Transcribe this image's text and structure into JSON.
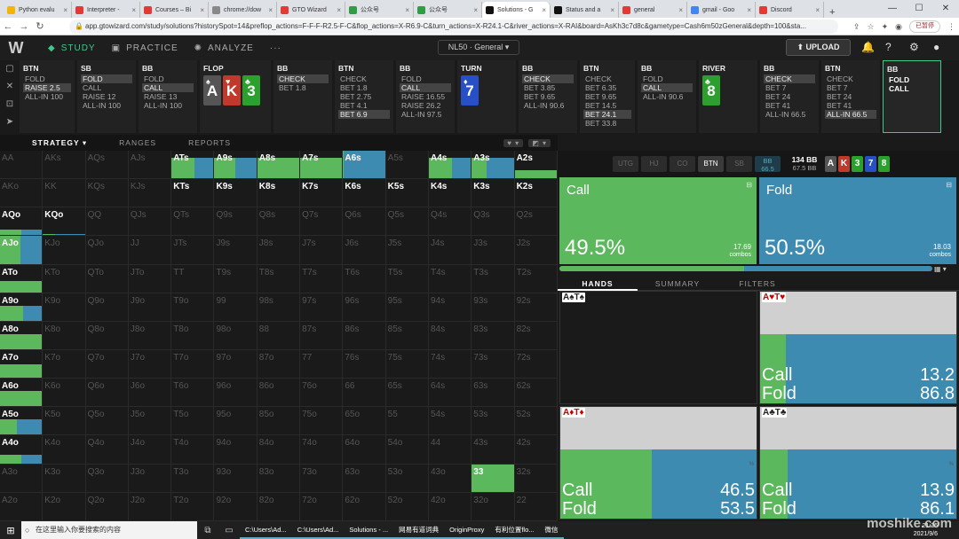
{
  "browser": {
    "tabs": [
      {
        "label": "Python evalu",
        "color": "#f4b400"
      },
      {
        "label": "Interpreter -",
        "color": "#e53935"
      },
      {
        "label": "Courses – Bi",
        "color": "#e53935"
      },
      {
        "label": "chrome://dow",
        "color": "#888"
      },
      {
        "label": "GTO Wizard",
        "color": "#e53935"
      },
      {
        "label": "公众号",
        "color": "#2e9e44"
      },
      {
        "label": "公众号",
        "color": "#2e9e44"
      },
      {
        "label": "Solutions - G",
        "color": "#111",
        "active": true
      },
      {
        "label": "Status and a",
        "color": "#111"
      },
      {
        "label": "general",
        "color": "#e53935"
      },
      {
        "label": "gmail - Goo",
        "color": "#4285f4"
      },
      {
        "label": "Discord",
        "color": "#e53935"
      }
    ],
    "new_tab": "+",
    "url": "app.gtowizard.com/study/solutions?historySpot=14&preflop_actions=F-F-F-R2.5-F-C&flop_actions=X-R6.9-C&turn_actions=X-R24.1-C&river_actions=X-RAI&board=AsKh3c7d8c&gametype=Cash6m50zGeneral&depth=100&sta...",
    "paused_label": "已暂停"
  },
  "appnav": {
    "logo": "W",
    "study": "STUDY",
    "practice": "PRACTICE",
    "analyze": "ANALYZE",
    "more": "···",
    "spot": "NL50 · General",
    "upload": "UPLOAD"
  },
  "action_columns": [
    {
      "title": "BTN",
      "options": [
        {
          "t": "FOLD"
        },
        {
          "t": "RAISE 2.5",
          "sel": true
        },
        {
          "t": "ALL-IN 100"
        }
      ],
      "w": 62
    },
    {
      "title": "SB",
      "options": [
        {
          "t": "FOLD",
          "sel": true
        },
        {
          "t": "CALL"
        },
        {
          "t": "RAISE 12"
        },
        {
          "t": "ALL-IN 100"
        }
      ],
      "w": 66
    },
    {
      "title": "BB",
      "options": [
        {
          "t": "FOLD"
        },
        {
          "t": "CALL",
          "sel": true
        },
        {
          "t": "RAISE 13"
        },
        {
          "t": "ALL-IN 100"
        }
      ],
      "w": 66
    },
    {
      "title": "FLOP",
      "cards": [
        {
          "r": "A",
          "s": "♠",
          "col": "#555"
        },
        {
          "r": "K",
          "s": "♥",
          "col": "#c0392b"
        },
        {
          "r": "3",
          "s": "♣",
          "col": "#2ca02c"
        }
      ],
      "w": 80
    },
    {
      "title": "BB",
      "options": [
        {
          "t": "CHECK",
          "sel": true
        },
        {
          "t": "BET 1.8"
        }
      ],
      "w": 66
    },
    {
      "title": "BTN",
      "options": [
        {
          "t": "CHECK"
        },
        {
          "t": "BET 1.8"
        },
        {
          "t": "BET 2.75"
        },
        {
          "t": "BET 4.1"
        },
        {
          "t": "BET 6.9",
          "sel": true
        }
      ],
      "w": 66
    },
    {
      "title": "BB",
      "options": [
        {
          "t": "FOLD"
        },
        {
          "t": "CALL",
          "sel": true
        },
        {
          "t": "RAISE 16.55"
        },
        {
          "t": "RAISE 26.2"
        },
        {
          "t": "ALL-IN 97.5"
        }
      ],
      "w": 66
    },
    {
      "title": "TURN",
      "cards": [
        {
          "r": "7",
          "s": "♦",
          "col": "#2750c8"
        }
      ],
      "w": 66
    },
    {
      "title": "BB",
      "options": [
        {
          "t": "CHECK",
          "sel": true
        },
        {
          "t": "BET 3.85"
        },
        {
          "t": "BET 9.65"
        },
        {
          "t": "ALL-IN 90.6"
        }
      ],
      "w": 66
    },
    {
      "title": "BTN",
      "options": [
        {
          "t": "CHECK"
        },
        {
          "t": "BET 6.35"
        },
        {
          "t": "BET 9.65"
        },
        {
          "t": "BET 14.5"
        },
        {
          "t": "BET 24.1",
          "sel": true
        },
        {
          "t": "BET 33.8"
        }
      ],
      "w": 62
    },
    {
      "title": "BB",
      "options": [
        {
          "t": "FOLD"
        },
        {
          "t": "CALL",
          "sel": true
        },
        {
          "t": "ALL-IN 90.6"
        }
      ],
      "w": 66
    },
    {
      "title": "RIVER",
      "cards": [
        {
          "r": "8",
          "s": "♣",
          "col": "#2ca02c"
        }
      ],
      "w": 66
    },
    {
      "title": "BB",
      "options": [
        {
          "t": "CHECK",
          "sel": true
        },
        {
          "t": "BET 7"
        },
        {
          "t": "BET 24"
        },
        {
          "t": "BET 41"
        },
        {
          "t": "ALL-IN 66.5"
        }
      ],
      "w": 66
    },
    {
      "title": "BTN",
      "options": [
        {
          "t": "CHECK"
        },
        {
          "t": "BET 7"
        },
        {
          "t": "BET 24"
        },
        {
          "t": "BET 41"
        },
        {
          "t": "ALL-IN 66.5",
          "sel": true
        }
      ],
      "w": 66
    },
    {
      "title": "BB",
      "options": [
        {
          "t": "FOLD",
          "bold": true
        },
        {
          "t": "CALL",
          "bold": true
        }
      ],
      "w": 66,
      "last": true
    }
  ],
  "subtabs": {
    "strategy": "STRATEGY",
    "ranges": "RANGES",
    "reports": "REPORTS"
  },
  "grid": [
    [
      "AA",
      "AKs",
      "AQs",
      "AJs",
      "ATs",
      "A9s",
      "A8s",
      "A7s",
      "A6s",
      "A5s",
      "A4s",
      "A3s",
      "A2s"
    ],
    [
      "AKo",
      "KK",
      "KQs",
      "KJs",
      "KTs",
      "K9s",
      "K8s",
      "K7s",
      "K6s",
      "K5s",
      "K4s",
      "K3s",
      "K2s"
    ],
    [
      "AQo",
      "KQo",
      "QQ",
      "QJs",
      "QTs",
      "Q9s",
      "Q8s",
      "Q7s",
      "Q6s",
      "Q5s",
      "Q4s",
      "Q3s",
      "Q2s"
    ],
    [
      "AJo",
      "KJo",
      "QJo",
      "JJ",
      "JTs",
      "J9s",
      "J8s",
      "J7s",
      "J6s",
      "J5s",
      "J4s",
      "J3s",
      "J2s"
    ],
    [
      "ATo",
      "KTo",
      "QTo",
      "JTo",
      "TT",
      "T9s",
      "T8s",
      "T7s",
      "T6s",
      "T5s",
      "T4s",
      "T3s",
      "T2s"
    ],
    [
      "A9o",
      "K9o",
      "Q9o",
      "J9o",
      "T9o",
      "99",
      "98s",
      "97s",
      "96s",
      "95s",
      "94s",
      "93s",
      "92s"
    ],
    [
      "A8o",
      "K8o",
      "Q8o",
      "J8o",
      "T8o",
      "98o",
      "88",
      "87s",
      "86s",
      "85s",
      "84s",
      "83s",
      "82s"
    ],
    [
      "A7o",
      "K7o",
      "Q7o",
      "J7o",
      "T7o",
      "97o",
      "87o",
      "77",
      "76s",
      "75s",
      "74s",
      "73s",
      "72s"
    ],
    [
      "A6o",
      "K6o",
      "Q6o",
      "J6o",
      "T6o",
      "96o",
      "86o",
      "76o",
      "66",
      "65s",
      "64s",
      "63s",
      "62s"
    ],
    [
      "A5o",
      "K5o",
      "Q5o",
      "J5o",
      "T5o",
      "95o",
      "85o",
      "75o",
      "65o",
      "55",
      "54s",
      "53s",
      "52s"
    ],
    [
      "A4o",
      "K4o",
      "Q4o",
      "J4o",
      "T4o",
      "94o",
      "84o",
      "74o",
      "64o",
      "54o",
      "44",
      "43s",
      "42s"
    ],
    [
      "A3o",
      "K3o",
      "Q3o",
      "J3o",
      "T3o",
      "93o",
      "83o",
      "73o",
      "63o",
      "53o",
      "43o",
      "33",
      "32s"
    ],
    [
      "A2o",
      "K2o",
      "Q2o",
      "J2o",
      "T2o",
      "92o",
      "82o",
      "72o",
      "62o",
      "52o",
      "42o",
      "32o",
      "22"
    ]
  ],
  "grid_fills": {
    "ATs": {
      "h": 0.75,
      "call": 0.55,
      "fold": 0.45
    },
    "A9s": {
      "h": 0.75,
      "call": 0.5,
      "fold": 0.5
    },
    "A8s": {
      "h": 0.75,
      "call": 1,
      "fold": 0
    },
    "A7s": {
      "h": 0.75,
      "call": 1,
      "fold": 0
    },
    "A6s": {
      "h": 1,
      "call": 0.02,
      "fold": 0.98
    },
    "A4s": {
      "h": 0.75,
      "call": 0.55,
      "fold": 0.45
    },
    "A3s": {
      "h": 0.75,
      "call": 0.35,
      "fold": 0.65
    },
    "A2s": {
      "h": 0.3,
      "call": 1,
      "fold": 0
    },
    "AQo": {
      "h": 0.22,
      "call": 0.5,
      "fold": 0.5
    },
    "KQo": {
      "h": 0.06,
      "call": 0.3,
      "fold": 0.7
    },
    "AJo": {
      "h": 1,
      "call": 0.48,
      "fold": 0.52
    },
    "ATo": {
      "h": 0.4,
      "call": 1,
      "fold": 0
    },
    "A9o": {
      "h": 0.55,
      "call": 0.55,
      "fold": 0.45
    },
    "A8o": {
      "h": 0.55,
      "call": 1,
      "fold": 0
    },
    "A7o": {
      "h": 0.5,
      "call": 1,
      "fold": 0
    },
    "A6o": {
      "h": 0.55,
      "call": 1,
      "fold": 0
    },
    "A5o": {
      "h": 0.55,
      "call": 0.4,
      "fold": 0.6
    },
    "A4o": {
      "h": 0.3,
      "call": 0.5,
      "fold": 0.5
    },
    "33": {
      "h": 1,
      "call": 1,
      "fold": 0
    }
  },
  "hot_cells": [
    "ATs",
    "A9s",
    "A8s",
    "A7s",
    "A6s",
    "A4s",
    "A3s",
    "A2s",
    "KTs",
    "K9s",
    "K8s",
    "K7s",
    "K6s",
    "K5s",
    "K4s",
    "K3s",
    "K2s",
    "AQo",
    "KQo",
    "AJo",
    "ATo",
    "A9o",
    "A8o",
    "A7o",
    "A6o",
    "A5o",
    "A4o",
    "33"
  ],
  "positions": [
    "UTG",
    "HJ",
    "CO",
    "BTN",
    "SB"
  ],
  "bb_pos": {
    "label": "BB",
    "stack": "66.5"
  },
  "pot": {
    "value": "134 BB",
    "sub": "67.5 BB"
  },
  "mini_board": [
    {
      "r": "A",
      "col": "#555"
    },
    {
      "r": "K",
      "col": "#c0392b"
    },
    {
      "r": "3",
      "col": "#2ca02c"
    },
    {
      "r": "7",
      "col": "#2750c8"
    },
    {
      "r": "8",
      "col": "#2ca02c"
    }
  ],
  "action_summary": {
    "call": {
      "name": "Call",
      "pct": "49.5%",
      "combos": "17.69",
      "combos_label": "combos"
    },
    "fold": {
      "name": "Fold",
      "pct": "50.5%",
      "combos": "18.03",
      "combos_label": "combos"
    },
    "call_fraction": 0.495
  },
  "hand_tabs": {
    "hands": "HANDS",
    "summary": "SUMMARY",
    "filters": "FILTERS"
  },
  "combos": [
    {
      "r1": "A",
      "s1": "♠",
      "red1": false,
      "r2": "T",
      "s2": "♠",
      "red2": false,
      "empty": true
    },
    {
      "r1": "A",
      "s1": "♥",
      "red1": true,
      "r2": "T",
      "s2": "♥",
      "red2": true,
      "call": "13.2",
      "fold": "86.8",
      "callf": 0.132
    },
    {
      "r1": "A",
      "s1": "♦",
      "red1": true,
      "r2": "T",
      "s2": "♦",
      "red2": true,
      "call": "46.5",
      "fold": "53.5",
      "callf": 0.465
    },
    {
      "r1": "A",
      "s1": "♣",
      "red1": false,
      "r2": "T",
      "s2": "♣",
      "red2": false,
      "call": "13.9",
      "fold": "86.1",
      "callf": 0.139
    }
  ],
  "combo_labels": {
    "call": "Call",
    "fold": "Fold"
  },
  "taskbar": {
    "search": "在这里输入你要搜索的内容",
    "items": [
      "C:\\Users\\Ad...",
      "C:\\Users\\Ad...",
      "Solutions - ...",
      "网易有道词典",
      "OriginProxy",
      "有利位置flo...",
      "微信"
    ],
    "time": "21:26",
    "date": "2021/9/6"
  },
  "watermark": "moshike.com"
}
